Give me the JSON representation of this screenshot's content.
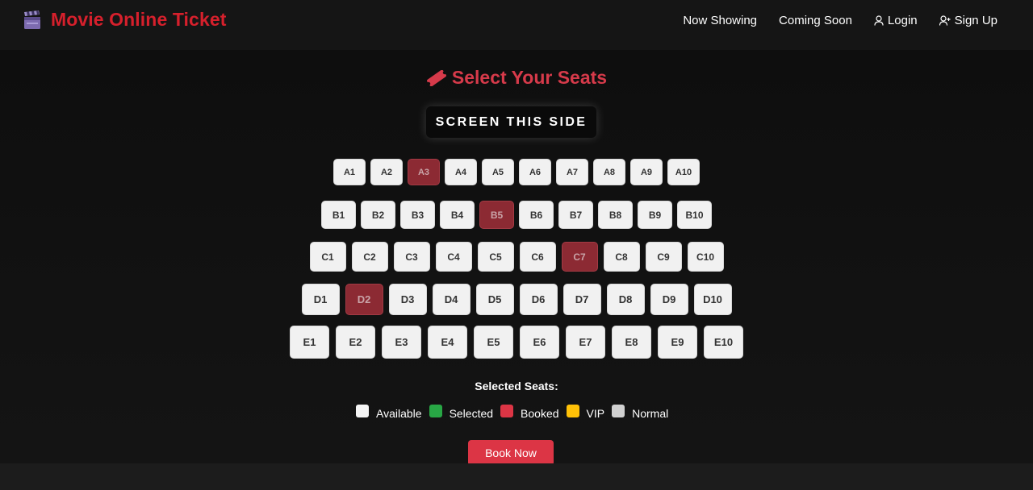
{
  "navbar": {
    "brand": "Movie Online Ticket",
    "brand_icon": "clapperboard-icon",
    "links": [
      {
        "label": "Now Showing",
        "icon": ""
      },
      {
        "label": "Coming Soon",
        "icon": ""
      },
      {
        "label": "Login",
        "icon": "user-icon"
      },
      {
        "label": "Sign Up",
        "icon": "user-plus-icon"
      }
    ]
  },
  "page": {
    "title": "Select Your Seats",
    "title_icon": "ticket-icon",
    "screen_label": "SCREEN THIS SIDE"
  },
  "seats": {
    "rows": [
      {
        "row": "A",
        "seats": [
          "A1",
          "A2",
          "A3",
          "A4",
          "A5",
          "A6",
          "A7",
          "A8",
          "A9",
          "A10"
        ],
        "booked": [
          "A3"
        ]
      },
      {
        "row": "B",
        "seats": [
          "B1",
          "B2",
          "B3",
          "B4",
          "B5",
          "B6",
          "B7",
          "B8",
          "B9",
          "B10"
        ],
        "booked": [
          "B5"
        ]
      },
      {
        "row": "C",
        "seats": [
          "C1",
          "C2",
          "C3",
          "C4",
          "C5",
          "C6",
          "C7",
          "C8",
          "C9",
          "C10"
        ],
        "booked": [
          "C7"
        ]
      },
      {
        "row": "D",
        "seats": [
          "D1",
          "D2",
          "D3",
          "D4",
          "D5",
          "D6",
          "D7",
          "D8",
          "D9",
          "D10"
        ],
        "booked": [
          "D2"
        ]
      },
      {
        "row": "E",
        "seats": [
          "E1",
          "E2",
          "E3",
          "E4",
          "E5",
          "E6",
          "E7",
          "E8",
          "E9",
          "E10"
        ],
        "booked": []
      }
    ]
  },
  "selection": {
    "label": "Selected Seats:"
  },
  "legend": [
    {
      "label": "Available",
      "color": "#f5f5f5"
    },
    {
      "label": "Selected",
      "color": "#28a745"
    },
    {
      "label": "Booked",
      "color": "#dc3545"
    },
    {
      "label": "VIP",
      "color": "#ffc107"
    },
    {
      "label": "Normal",
      "color": "#d0d0d0"
    }
  ],
  "actions": {
    "book_label": "Book Now"
  },
  "colors": {
    "brand": "#d6202c",
    "title": "#d63a4a",
    "booked_seat": "#8c2a33",
    "available_seat": "#f1f1f1",
    "button": "#dc3545"
  }
}
